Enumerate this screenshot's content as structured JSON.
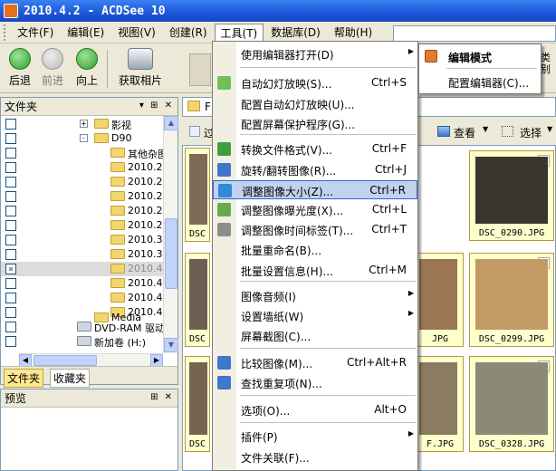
{
  "window": {
    "title": "2010.4.2 - ACDSee 10"
  },
  "menubar": {
    "items": [
      "文件(F)",
      "编辑(E)",
      "视图(V)",
      "创建(R)",
      "工具(T)",
      "数据库(D)",
      "帮助(H)"
    ]
  },
  "toolbar": {
    "back": "后退",
    "forward": "前进",
    "up": "向上",
    "acquire": "获取相片"
  },
  "folder_pane": {
    "title": "文件夹",
    "tree": [
      {
        "label": "影视",
        "expander": "+"
      },
      {
        "label": "D90",
        "expander": "-"
      },
      {
        "label": "其他杂图"
      },
      {
        "label": "2010.2."
      },
      {
        "label": "2010.2."
      },
      {
        "label": "2010.2."
      },
      {
        "label": "2010.2."
      },
      {
        "label": "2010.2."
      },
      {
        "label": "2010.3."
      },
      {
        "label": "2010.3."
      },
      {
        "label": "2010.4."
      },
      {
        "label": "2010.4."
      },
      {
        "label": "2010.4."
      },
      {
        "label": "2010.4."
      },
      {
        "label": "Media"
      },
      {
        "label": "DVD-RAM 驱动器"
      },
      {
        "label": "新加卷 (H:)"
      }
    ],
    "tabs": [
      "文件夹",
      "收藏夹"
    ]
  },
  "preview_pane": {
    "title": "预览"
  },
  "browser": {
    "path_letter": "F",
    "filter_partial": "过",
    "view_label": "查看",
    "select_label": "选择",
    "right_fragments": [
      "类别",
      "无文"
    ],
    "captions": [
      "DSC",
      "DSC_0290.JPG",
      "DSC",
      "JPG",
      "DSC_0299.JPG",
      "DSC",
      "F.JPG",
      "DSC_0328.JPG"
    ]
  },
  "tools_menu": {
    "items": [
      {
        "label": "使用编辑器打开(D)",
        "shortcut": "",
        "submenu": true
      },
      {
        "label": "自动幻灯放映(S)...",
        "shortcut": "Ctrl+S"
      },
      {
        "label": "配置自动幻灯放映(U)...",
        "shortcut": ""
      },
      {
        "label": "配置屏幕保护程序(G)...",
        "shortcut": ""
      },
      {
        "label": "转换文件格式(V)...",
        "shortcut": "Ctrl+F"
      },
      {
        "label": "旋转/翻转图像(R)...",
        "shortcut": "Ctrl+J"
      },
      {
        "label": "调整图像大小(Z)...",
        "shortcut": "Ctrl+R"
      },
      {
        "label": "调整图像曝光度(X)...",
        "shortcut": "Ctrl+L"
      },
      {
        "label": "调整图像时间标签(T)...",
        "shortcut": "Ctrl+T"
      },
      {
        "label": "批量重命名(B)...",
        "shortcut": ""
      },
      {
        "label": "批量设置信息(H)...",
        "shortcut": "Ctrl+M"
      },
      {
        "label": "图像音频(I)",
        "shortcut": "",
        "submenu": true
      },
      {
        "label": "设置墙纸(W)",
        "shortcut": "",
        "submenu": true
      },
      {
        "label": "屏幕截图(C)...",
        "shortcut": ""
      },
      {
        "label": "比较图像(M)...",
        "shortcut": "Ctrl+Alt+R"
      },
      {
        "label": "查找重复项(N)...",
        "shortcut": ""
      },
      {
        "label": "选项(O)...",
        "shortcut": "Alt+O"
      },
      {
        "label": "插件(P)",
        "shortcut": "",
        "submenu": true
      },
      {
        "label": "文件关联(F)...",
        "shortcut": ""
      }
    ],
    "highlighted": "调整图像大小(Z)..."
  },
  "editor_submenu": {
    "items": [
      "编辑模式",
      "配置编辑器(C)..."
    ]
  },
  "colors": {
    "title_bar": "#1c56d8",
    "highlight": "#c1d2ee",
    "highlight_border": "#316ac5",
    "thumb_bg": "#ffffcc"
  }
}
